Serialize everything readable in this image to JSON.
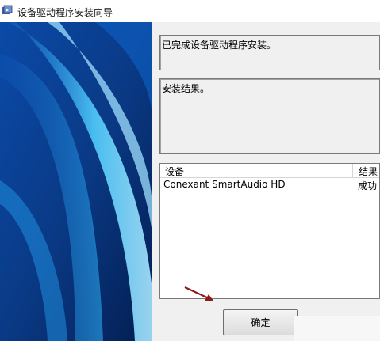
{
  "window": {
    "title": "设备驱动程序安装向导",
    "icon": "installer-icon"
  },
  "status_text": "已完成设备驱动程序安装。",
  "result_label": "安装结果。",
  "device_list": {
    "columns": [
      "设备",
      "结果"
    ],
    "rows": [
      {
        "device": "Conexant SmartAudio HD",
        "result": "成功"
      }
    ]
  },
  "ok_button": {
    "label": "确定"
  },
  "colors": {
    "banner_dark": "#062a66",
    "banner_light": "#3fb6f0",
    "panel_bg": "#f0f0f0",
    "annotation_arrow": "#8b1a1a"
  }
}
